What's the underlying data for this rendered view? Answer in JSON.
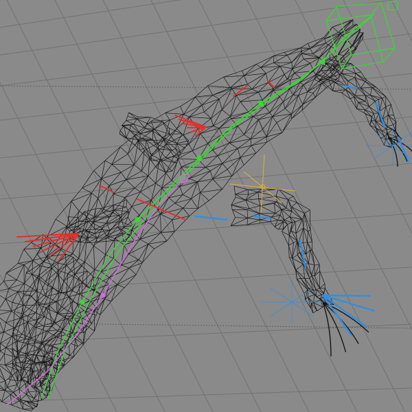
{
  "viewport": {
    "background": "#8a8a8a",
    "grid_color": "#6f6f6f",
    "wire_color": "#141414",
    "colors": {
      "spine_bone": "#39d833",
      "tail_bone": "#d46ae0",
      "left_limbs": "#e0302c",
      "right_limbs": "#2f8fe6",
      "pivot": "#e2b13a",
      "helper_box": "#3fd23c"
    }
  }
}
